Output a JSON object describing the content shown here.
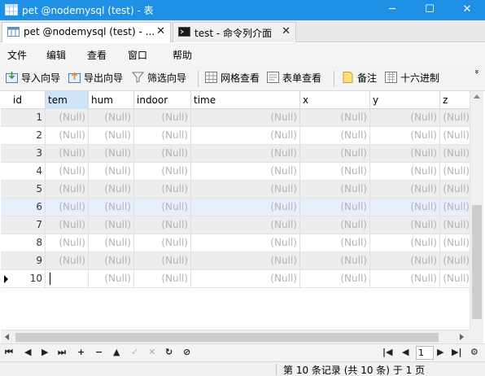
{
  "window": {
    "title": "pet @nodemysql (test) - 表",
    "controls": {
      "minimize": "─",
      "maximize": "☐",
      "close": "✕"
    }
  },
  "tabs": [
    {
      "label": "pet @nodemysql (test) - ...",
      "close": "✕",
      "icon": "table-icon"
    },
    {
      "label": "test - 命令列介面",
      "close": "✕",
      "icon": "console-icon"
    }
  ],
  "menu": [
    "文件",
    "编辑",
    "查看",
    "窗口",
    "帮助"
  ],
  "toolbar": {
    "import_wizard": "导入向导",
    "export_wizard": "导出向导",
    "filter_wizard": "筛选向导",
    "grid_view": "网格查看",
    "form_view": "表单查看",
    "memo": "备注",
    "hex": "十六进制",
    "more": "»"
  },
  "grid": {
    "columns": [
      "id",
      "tem",
      "hum",
      "indoor",
      "time",
      "x",
      "y",
      "z"
    ],
    "selected_column": "tem",
    "null_text": "(Null)",
    "rows": [
      {
        "id": "1",
        "cells": [
          "(Null)",
          "(Null)",
          "(Null)",
          "(Null)",
          "(Null)",
          "(Null)",
          "(Null)"
        ]
      },
      {
        "id": "2",
        "cells": [
          "(Null)",
          "(Null)",
          "(Null)",
          "(Null)",
          "(Null)",
          "(Null)",
          "(Null)"
        ]
      },
      {
        "id": "3",
        "cells": [
          "(Null)",
          "(Null)",
          "(Null)",
          "(Null)",
          "(Null)",
          "(Null)",
          "(Null)"
        ]
      },
      {
        "id": "4",
        "cells": [
          "(Null)",
          "(Null)",
          "(Null)",
          "(Null)",
          "(Null)",
          "(Null)",
          "(Null)"
        ]
      },
      {
        "id": "5",
        "cells": [
          "(Null)",
          "(Null)",
          "(Null)",
          "(Null)",
          "(Null)",
          "(Null)",
          "(Null)"
        ]
      },
      {
        "id": "6",
        "cells": [
          "(Null)",
          "(Null)",
          "(Null)",
          "(Null)",
          "(Null)",
          "(Null)",
          "(Null)"
        ]
      },
      {
        "id": "7",
        "cells": [
          "(Null)",
          "(Null)",
          "(Null)",
          "(Null)",
          "(Null)",
          "(Null)",
          "(Null)"
        ]
      },
      {
        "id": "8",
        "cells": [
          "(Null)",
          "(Null)",
          "(Null)",
          "(Null)",
          "(Null)",
          "(Null)",
          "(Null)"
        ]
      },
      {
        "id": "9",
        "cells": [
          "(Null)",
          "(Null)",
          "(Null)",
          "(Null)",
          "(Null)",
          "(Null)",
          "(Null)"
        ]
      },
      {
        "id": "10",
        "cells": [
          "",
          "(Null)",
          "(Null)",
          "(Null)",
          "(Null)",
          "(Null)",
          "(Null)"
        ]
      }
    ],
    "current_row": "10",
    "highlighted_row": "6"
  },
  "navigation": {
    "first": "⏮",
    "prev": "◀",
    "next": "▶",
    "last": "⏭",
    "add": "+",
    "delete": "−",
    "apply": "▲",
    "check": "✓",
    "cancel": "✕",
    "refresh": "↻",
    "stop": "⊘",
    "page_first": "|◀",
    "page_prev": "◀",
    "page_value": "1",
    "page_next": "▶",
    "page_last": "▶|",
    "settings": "⚙"
  },
  "status": {
    "text": "第 10 条记录 (共 10 条) 于 1 页"
  },
  "colors": {
    "titlebar": "#1e90e6",
    "selected_header": "#cfe4f7",
    "alt_row": "#ededed",
    "null_text": "#b4b4b4"
  }
}
